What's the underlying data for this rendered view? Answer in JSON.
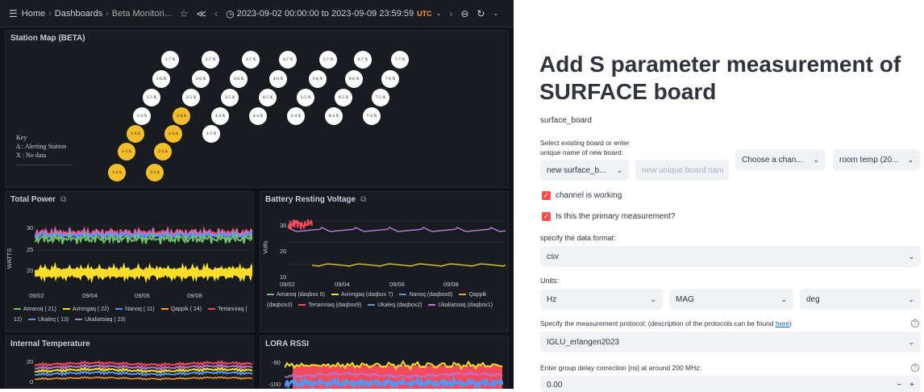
{
  "topbar": {
    "home": "Home",
    "dashboards": "Dashboards",
    "current": "Beta Monitori...",
    "time_range": "2023-09-02 00:00:00 to 2023-09-09 23:59:59",
    "timezone": "UTC"
  },
  "station_map": {
    "title": "Station Map (BETA)",
    "key_title": "Key",
    "key_alert": "Δ : Alerting Station",
    "key_nodata": "X : No data",
    "stations": [
      {
        "label": "1-7 X",
        "alert": false
      },
      {
        "label": "2-7 X",
        "alert": false
      },
      {
        "label": "3-7 X",
        "alert": false
      },
      {
        "label": "4-7 X",
        "alert": false
      },
      {
        "label": "5-7 X",
        "alert": false
      },
      {
        "label": "6-7 X",
        "alert": false
      },
      {
        "label": "7-7 X",
        "alert": false
      },
      {
        "label": "1-6 X",
        "alert": false
      },
      {
        "label": "2-6 X",
        "alert": false
      },
      {
        "label": "3-6 X",
        "alert": false
      },
      {
        "label": "4-6 X",
        "alert": false
      },
      {
        "label": "5-6 X",
        "alert": false
      },
      {
        "label": "6-6 X",
        "alert": false
      },
      {
        "label": "7-6 X",
        "alert": false
      },
      {
        "label": "1-5 X",
        "alert": false
      },
      {
        "label": "2-5 X",
        "alert": false
      },
      {
        "label": "3-5 X",
        "alert": false
      },
      {
        "label": "4-5 X",
        "alert": false
      },
      {
        "label": "5-5 X",
        "alert": false
      },
      {
        "label": "6-5 X",
        "alert": false
      },
      {
        "label": "7-5 X",
        "alert": false
      },
      {
        "label": "1-4 X",
        "alert": false
      },
      {
        "label": "2-4 Δ",
        "alert": true
      },
      {
        "label": "3-4 X",
        "alert": false
      },
      {
        "label": "4-4 X",
        "alert": false
      },
      {
        "label": "5-4 X",
        "alert": false
      },
      {
        "label": "6-4 X",
        "alert": false
      },
      {
        "label": "7-4 X",
        "alert": false
      },
      {
        "label": "1-3 Δ",
        "alert": true
      },
      {
        "label": "2-3 Δ",
        "alert": true
      },
      {
        "label": "3-3 X",
        "alert": false
      },
      {
        "label": "1-2 Δ",
        "alert": true
      },
      {
        "label": "2-2 Δ",
        "alert": true
      },
      {
        "label": "1-1 Δ",
        "alert": true
      },
      {
        "label": "2-1 Δ",
        "alert": true
      }
    ]
  },
  "total_power": {
    "title": "Total Power",
    "ylabel": "WATTS",
    "yticks": [
      "30",
      "25",
      "20"
    ],
    "xticks": [
      "09/02",
      "09/04",
      "09/06",
      "09/08"
    ],
    "legend": [
      {
        "name": "Amaroq ( 21)",
        "color": "#73bf69"
      },
      {
        "name": "Avinngaq ( 22)",
        "color": "#fade2a"
      },
      {
        "name": "Nanoq ( 11)",
        "color": "#5794f2"
      },
      {
        "name": "Qappik ( 24)",
        "color": "#ff9830"
      },
      {
        "name": "Terianniaq ( 12)",
        "color": "#f2495c"
      },
      {
        "name": "Ukaleq ( 13)",
        "color": "#5794f2"
      },
      {
        "name": "Ukaliatsiaq ( 23)",
        "color": "#b877d9"
      }
    ]
  },
  "battery": {
    "title": "Battery Resting Voltage",
    "ylabel": "Volts",
    "yticks": [
      "30",
      "20",
      "10"
    ],
    "xticks": [
      "09/02",
      "09/04",
      "09/06",
      "09/08"
    ],
    "legend": [
      {
        "name": "Amaroq (daqbox 6)",
        "color": "#73bf69"
      },
      {
        "name": "Avinngaq (daqbox 7)",
        "color": "#fade2a"
      },
      {
        "name": "Nanoq (daqbox8)",
        "color": "#5794f2"
      },
      {
        "name": "Qappik (daqbox3)",
        "color": "#ff9830"
      },
      {
        "name": "Terianniaq (daqbox9)",
        "color": "#f2495c"
      },
      {
        "name": "Ukaleq (daqbox2)",
        "color": "#5794f2"
      },
      {
        "name": "Ukaliatsiaq (daqbox1)",
        "color": "#b877d9"
      }
    ]
  },
  "internal_temp": {
    "title": "Internal Temperature",
    "yticks": [
      "20",
      "0"
    ]
  },
  "lora": {
    "title": "LORA RSSI",
    "yticks": [
      "-90",
      "-100"
    ]
  },
  "form": {
    "title": "Add S parameter measurement of SURFACE board",
    "board_label": "surface_board",
    "select_label_1": "Select existing board or enter",
    "select_label_2": "unique name of new board:",
    "board_select": "new surface_b...",
    "board_placeholder": "new unique board nam",
    "channel_select": "Choose a chan...",
    "temp_select": "room temp (20...",
    "chk_working": "channel is working",
    "chk_primary": "Is this the primary measurement?",
    "format_label": "specify the data format:",
    "format_value": "csv",
    "units_label": "Units:",
    "unit_1": "Hz",
    "unit_2": "MAG",
    "unit_3": "deg",
    "protocol_label": "Specify the measurement protocol: (description of the protocols can be found ",
    "protocol_link": "here",
    "protocol_close": ")",
    "protocol_value": "IGLU_erlangen2023",
    "delay_label": "Enter group delay correction [ns] at around 200 MHz:",
    "delay_value": "0.00"
  }
}
